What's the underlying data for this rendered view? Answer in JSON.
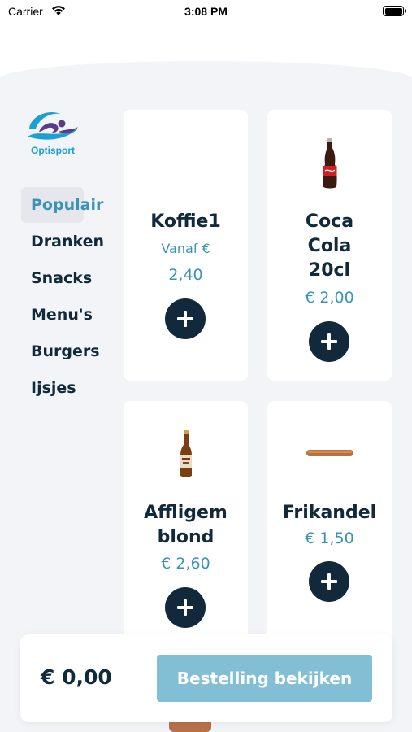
{
  "status_bar": {
    "carrier": "Carrier",
    "time": "3:08 PM"
  },
  "brand": {
    "name": "Optisport",
    "accent": "#1a9fd6",
    "purple": "#5b3a8e"
  },
  "categories": [
    {
      "label": "Populair",
      "active": true
    },
    {
      "label": "Dranken",
      "active": false
    },
    {
      "label": "Snacks",
      "active": false
    },
    {
      "label": "Menu's",
      "active": false
    },
    {
      "label": "Burgers",
      "active": false
    },
    {
      "label": "Ijsjes",
      "active": false
    }
  ],
  "products": [
    {
      "name_lines": [
        "Koffie1"
      ],
      "price_prefix": "Vanaf €",
      "price": "2,40",
      "image_icon": "none"
    },
    {
      "name_lines": [
        "Coca",
        "Cola",
        "20cl"
      ],
      "price": "€ 2,00",
      "image_icon": "coca-cola-bottle-icon"
    },
    {
      "name_lines": [
        "Affligem",
        "blond"
      ],
      "price": "€ 2,60",
      "image_icon": "beer-bottle-icon"
    },
    {
      "name_lines": [
        "Frikandel"
      ],
      "price": "€ 1,50",
      "image_icon": "frikandel-icon"
    }
  ],
  "footer": {
    "total": "€ 0,00",
    "cta_label": "Bestelling bekijken"
  },
  "colors": {
    "primary_dark": "#11293b",
    "price_blue": "#3a93b5",
    "cta_disabled": "#83bfd4",
    "background": "#f3f4f7"
  }
}
